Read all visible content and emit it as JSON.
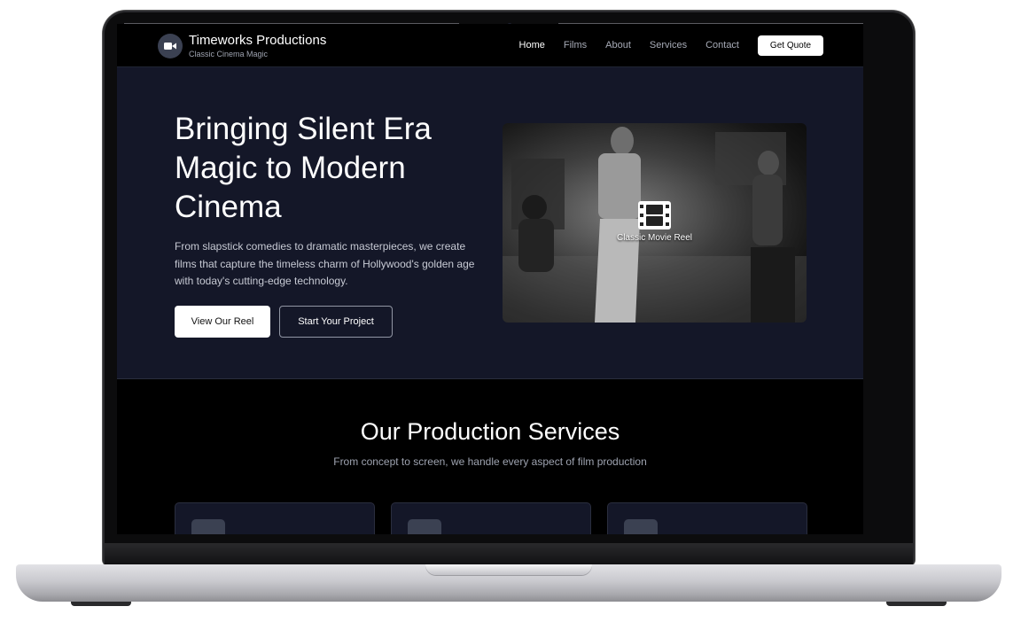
{
  "brand": {
    "title": "Timeworks Productions",
    "subtitle": "Classic Cinema Magic",
    "icon": "video-camera-icon"
  },
  "nav": {
    "items": [
      {
        "label": "Home",
        "active": true
      },
      {
        "label": "Films",
        "active": false
      },
      {
        "label": "About",
        "active": false
      },
      {
        "label": "Services",
        "active": false
      },
      {
        "label": "Contact",
        "active": false
      }
    ],
    "cta": "Get Quote"
  },
  "hero": {
    "title": "Bringing Silent Era Magic to Modern Cinema",
    "description": "From slapstick comedies to dramatic masterpieces, we create films that capture the timeless charm of Hollywood's golden age with today's cutting-edge technology.",
    "primary_button": "View Our Reel",
    "secondary_button": "Start Your Project",
    "media_caption": "Classic Movie Reel",
    "media_icon": "film-icon"
  },
  "services": {
    "title": "Our Production Services",
    "subtitle": "From concept to screen, we handle every aspect of film production",
    "card_icons": [
      "camera-icon",
      "clapperboard-icon",
      "megaphone-icon"
    ]
  },
  "colors": {
    "hero_bg": "#141728",
    "page_bg": "#000000",
    "text": "#ffffff",
    "muted": "#9ea3b0"
  }
}
